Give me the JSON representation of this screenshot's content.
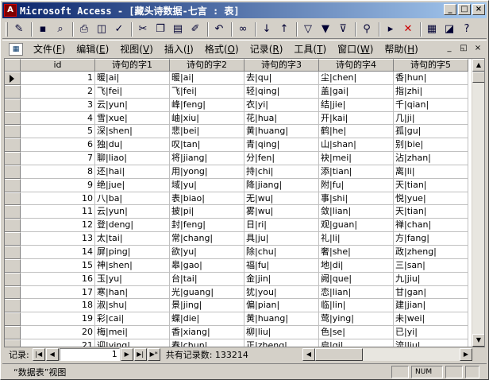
{
  "window": {
    "title": "Microsoft Access - [藏头诗数据-七言 : 表]",
    "app_icon": "access-key-icon"
  },
  "toolbar": {
    "buttons": [
      "design-view-icon",
      "save-icon",
      "search-file-icon",
      "print-icon",
      "print-preview-icon",
      "spelling-icon",
      "cut-icon",
      "copy-icon",
      "paste-icon",
      "format-painter-icon",
      "undo-icon",
      "hyperlink-icon",
      "sort-ascending-icon",
      "sort-descending-icon",
      "filter-by-selection-icon",
      "filter-by-form-icon",
      "apply-filter-icon",
      "find-icon",
      "new-record-icon",
      "delete-record-icon",
      "database-window-icon",
      "new-object-icon",
      "help-icon"
    ]
  },
  "menu": {
    "items": [
      {
        "label": "文件",
        "key": "F"
      },
      {
        "label": "编辑",
        "key": "E"
      },
      {
        "label": "视图",
        "key": "V"
      },
      {
        "label": "插入",
        "key": "I"
      },
      {
        "label": "格式",
        "key": "O"
      },
      {
        "label": "记录",
        "key": "R"
      },
      {
        "label": "工具",
        "key": "T"
      },
      {
        "label": "窗口",
        "key": "W"
      },
      {
        "label": "帮助",
        "key": "H"
      }
    ]
  },
  "table": {
    "columns": [
      "id",
      "诗句的字1",
      "诗句的字2",
      "诗句的字3",
      "诗句的字4",
      "诗句的字5"
    ],
    "rows": [
      [
        "1",
        "暖|ai|",
        "暖|ai|",
        "去|qu|",
        "尘|chen|",
        "香|hun|"
      ],
      [
        "2",
        "飞|fei|",
        "飞|fei|",
        "轻|qing|",
        "盖|gai|",
        "指|zhi|"
      ],
      [
        "3",
        "云|yun|",
        "峰|feng|",
        "衣|yi|",
        "结|jie|",
        "千|qian|"
      ],
      [
        "4",
        "雪|xue|",
        "岫|xiu|",
        "花|hua|",
        "开|kai|",
        "几|ji|"
      ],
      [
        "5",
        "深|shen|",
        "悲|bei|",
        "黄|huang|",
        "鹤|he|",
        "孤|gu|"
      ],
      [
        "6",
        "独|du|",
        "叹|tan|",
        "青|qing|",
        "山|shan|",
        "别|bie|"
      ],
      [
        "7",
        "聊|liao|",
        "将|jiang|",
        "分|fen|",
        "袂|mei|",
        "沾|zhan|"
      ],
      [
        "8",
        "还|hai|",
        "用|yong|",
        "持|chi|",
        "添|tian|",
        "离|li|"
      ],
      [
        "9",
        "绝|jue|",
        "域|yu|",
        "降|jiang|",
        "附|fu|",
        "天|tian|"
      ],
      [
        "10",
        "八|ba|",
        "表|biao|",
        "无|wu|",
        "事|shi|",
        "悦|yue|"
      ],
      [
        "11",
        "云|yun|",
        "披|pi|",
        "雾|wu|",
        "敛|lian|",
        "天|tian|"
      ],
      [
        "12",
        "登|deng|",
        "封|feng|",
        "日|ri|",
        "观|guan|",
        "禅|chan|"
      ],
      [
        "13",
        "太|tai|",
        "常|chang|",
        "具|ju|",
        "礼|li|",
        "方|fang|"
      ],
      [
        "14",
        "屏|ping|",
        "欲|yu|",
        "除|chu|",
        "奢|she|",
        "政|zheng|"
      ],
      [
        "15",
        "神|shen|",
        "皋|gao|",
        "福|fu|",
        "地|di|",
        "三|san|"
      ],
      [
        "16",
        "玉|yu|",
        "台|tai|",
        "金|jin|",
        "阙|que|",
        "九|jiu|"
      ],
      [
        "17",
        "寒|han|",
        "光|guang|",
        "犹|you|",
        "恋|lian|",
        "甘|gan|"
      ],
      [
        "18",
        "淑|shu|",
        "景|jing|",
        "偏|pian|",
        "临|lin|",
        "建|jian|"
      ],
      [
        "19",
        "彩|cai|",
        "蝶|die|",
        "黄|huang|",
        "莺|ying|",
        "未|wei|"
      ],
      [
        "20",
        "梅|mei|",
        "香|xiang|",
        "柳|liu|",
        "色|se|",
        "已|yi|"
      ],
      [
        "21",
        "迎|ying|",
        "春|chun|",
        "正|zheng|",
        "启|qi|",
        "流|liu|"
      ]
    ],
    "current_row": 0
  },
  "navigation": {
    "label": "记录:",
    "current": "1",
    "count_text": "共有记录数: 133214"
  },
  "status": {
    "text": "“数据表”视图",
    "panels": [
      "",
      "NUM",
      "",
      ""
    ]
  }
}
